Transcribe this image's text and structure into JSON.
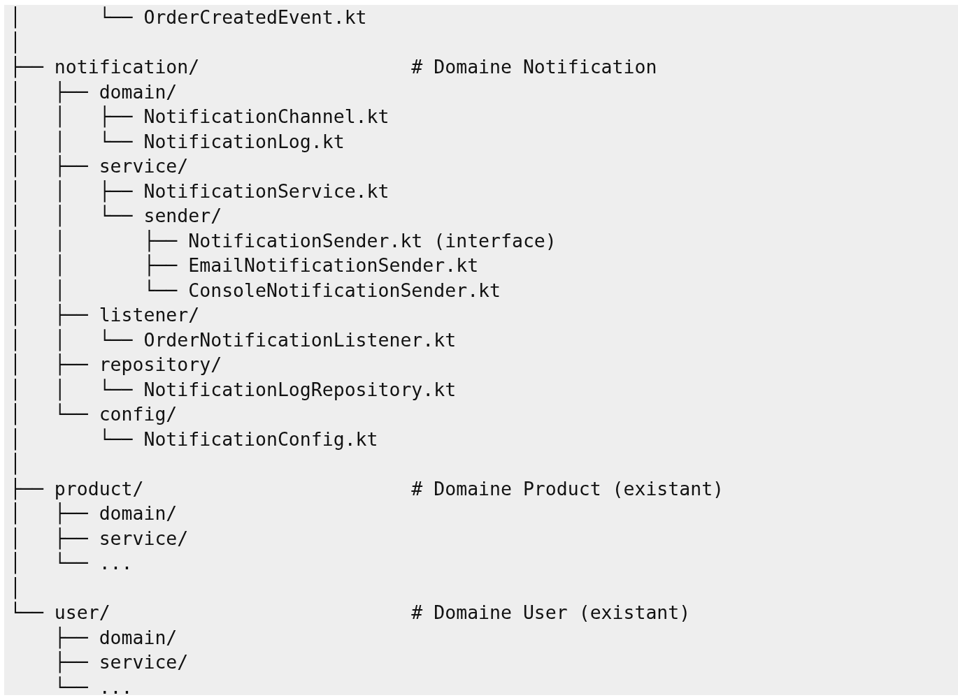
{
  "code_block": {
    "lines": [
      "│       └── OrderCreatedEvent.kt",
      "│",
      "├── notification/                   # Domaine Notification",
      "│   ├── domain/",
      "│   │   ├── NotificationChannel.kt",
      "│   │   └── NotificationLog.kt",
      "│   ├── service/",
      "│   │   ├── NotificationService.kt",
      "│   │   └── sender/",
      "│   │       ├── NotificationSender.kt (interface)",
      "│   │       ├── EmailNotificationSender.kt",
      "│   │       └── ConsoleNotificationSender.kt",
      "│   ├── listener/",
      "│   │   └── OrderNotificationListener.kt",
      "│   ├── repository/",
      "│   │   └── NotificationLogRepository.kt",
      "│   └── config/",
      "│       └── NotificationConfig.kt",
      "│",
      "├── product/                        # Domaine Product (existant)",
      "│   ├── domain/",
      "│   ├── service/",
      "│   └── ...",
      "│",
      "└── user/                           # Domaine User (existant)",
      "    ├── domain/",
      "    ├── service/",
      "    └── ..."
    ]
  }
}
